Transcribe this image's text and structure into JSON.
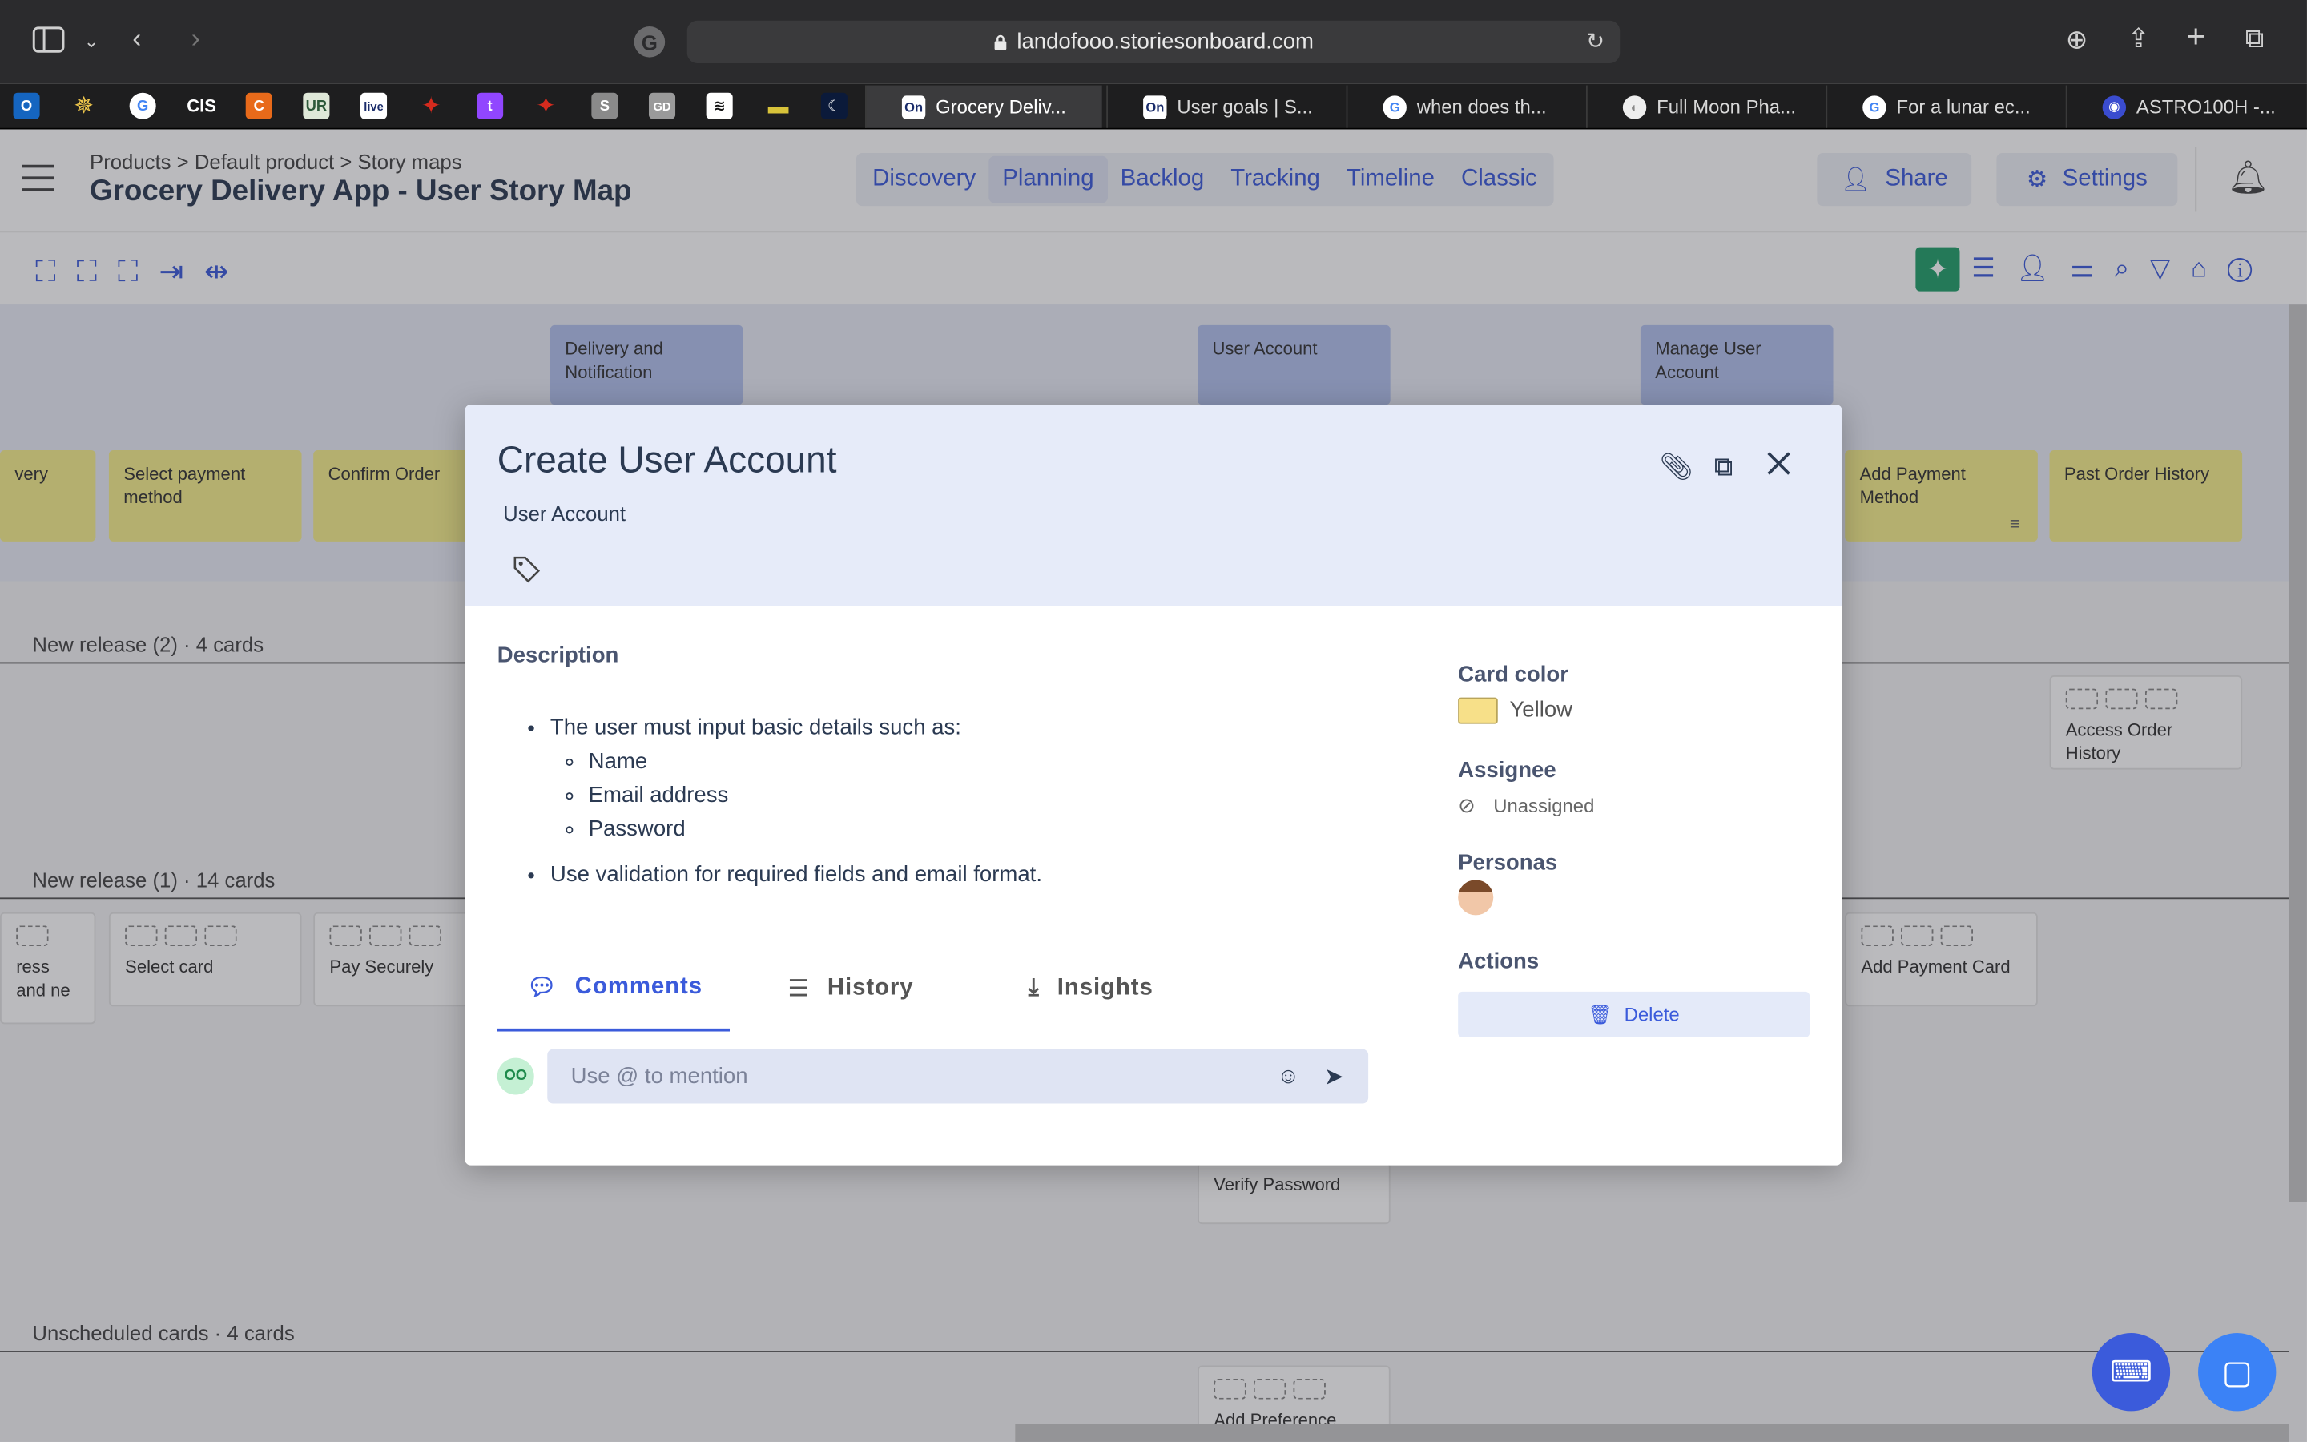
{
  "browser": {
    "url": "landofooo.storiesonboard.com",
    "tabs": [
      {
        "title": "Grocery Deliv...",
        "active": true
      },
      {
        "title": "User goals | S..."
      },
      {
        "title": "when does th..."
      },
      {
        "title": "Full Moon Pha..."
      },
      {
        "title": "For a lunar ec..."
      },
      {
        "title": "ASTRO100H -..."
      }
    ],
    "pinned_icons": [
      "outlook-icon",
      "star-icon",
      "google-icon",
      "cis-icon",
      "c-icon",
      "ur-icon",
      "live-icon",
      "maple-leaf-icon",
      "twitch-icon",
      "maple-leaf-icon",
      "s-icon",
      "gd-icon",
      "stripe-icon",
      "bar-icon",
      "moon-icon"
    ]
  },
  "header": {
    "breadcrumb": "Products > Default product > Story maps",
    "title": "Grocery Delivery App - User Story Map",
    "nav": [
      "Discovery",
      "Planning",
      "Backlog",
      "Tracking",
      "Timeline",
      "Classic"
    ],
    "share": "Share",
    "settings": "Settings"
  },
  "board": {
    "activities": [
      "Delivery and Notification",
      "User Account",
      "Manage User Account"
    ],
    "steps": [
      "very",
      "Select payment method",
      "Confirm Order",
      "Add Payment Method",
      "Past Order History"
    ],
    "releases": [
      "New release (2) · 4 cards",
      "New release (1) · 14 cards",
      "Unscheduled cards · 4 cards"
    ],
    "cards": [
      "Access Order History",
      "ress and ne",
      "Select card",
      "Pay Securely",
      "Add Payment Card",
      "Verify Password",
      "Add Preference"
    ]
  },
  "modal": {
    "title": "Create User Account",
    "subtitle": "User Account",
    "description_label": "Description",
    "description": {
      "intro": "The user must input basic details such as:",
      "fields": [
        "Name",
        "Email address",
        "Password"
      ],
      "rule": "Use validation for required fields and email format."
    },
    "tabs": [
      "Comments",
      "History",
      "Insights"
    ],
    "comment_avatar": "OO",
    "comment_placeholder": "Use @ to mention",
    "card_color_label": "Card color",
    "card_color": "Yellow",
    "card_color_hex": "#f7e089",
    "assignee_label": "Assignee",
    "assignee": "Unassigned",
    "personas_label": "Personas",
    "actions_label": "Actions",
    "delete": "Delete"
  }
}
